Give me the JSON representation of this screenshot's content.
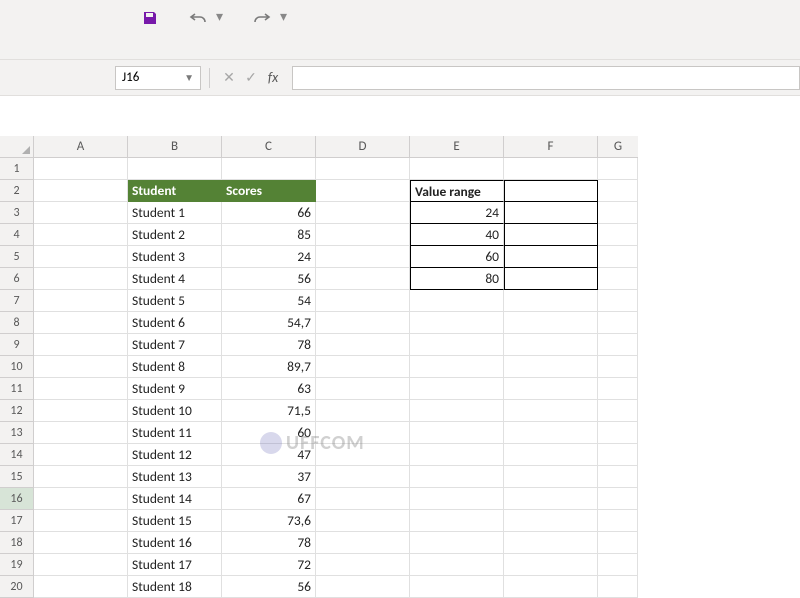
{
  "titlebar": {
    "save": "Save",
    "undo": "Undo",
    "redo": "Redo"
  },
  "formulabar": {
    "namebox": "J16",
    "cancel": "✕",
    "enter": "✓",
    "fx": "fx",
    "value": ""
  },
  "columns": [
    "A",
    "B",
    "C",
    "D",
    "E",
    "F",
    "G"
  ],
  "rows_visible": 20,
  "table_header": {
    "b": "Student",
    "c": "Scores"
  },
  "students": [
    {
      "name": "Student 1",
      "score": "66"
    },
    {
      "name": "Student 2",
      "score": "85"
    },
    {
      "name": "Student 3",
      "score": "24"
    },
    {
      "name": "Student 4",
      "score": "56"
    },
    {
      "name": "Student 5",
      "score": "54"
    },
    {
      "name": "Student 6",
      "score": "54,7"
    },
    {
      "name": "Student 7",
      "score": "78"
    },
    {
      "name": "Student 8",
      "score": "89,7"
    },
    {
      "name": "Student 9",
      "score": "63"
    },
    {
      "name": "Student 10",
      "score": "71,5"
    },
    {
      "name": "Student 11",
      "score": "60"
    },
    {
      "name": "Student 12",
      "score": "47"
    },
    {
      "name": "Student 13",
      "score": "37"
    },
    {
      "name": "Student 14",
      "score": "67"
    },
    {
      "name": "Student 15",
      "score": "73,6"
    },
    {
      "name": "Student 16",
      "score": "78"
    },
    {
      "name": "Student 17",
      "score": "72"
    },
    {
      "name": "Student 18",
      "score": "56"
    }
  ],
  "value_range": {
    "header": "Value range",
    "values": [
      "24",
      "40",
      "60",
      "80"
    ]
  },
  "watermark": "UFFCOM",
  "chart_data": {
    "type": "table",
    "title": "",
    "tables": [
      {
        "columns": [
          "Student",
          "Scores"
        ],
        "rows": [
          [
            "Student 1",
            66
          ],
          [
            "Student 2",
            85
          ],
          [
            "Student 3",
            24
          ],
          [
            "Student 4",
            56
          ],
          [
            "Student 5",
            54
          ],
          [
            "Student 6",
            54.7
          ],
          [
            "Student 7",
            78
          ],
          [
            "Student 8",
            89.7
          ],
          [
            "Student 9",
            63
          ],
          [
            "Student 10",
            71.5
          ],
          [
            "Student 11",
            60
          ],
          [
            "Student 12",
            47
          ],
          [
            "Student 13",
            37
          ],
          [
            "Student 14",
            67
          ],
          [
            "Student 15",
            73.6
          ],
          [
            "Student 16",
            78
          ],
          [
            "Student 17",
            72
          ],
          [
            "Student 18",
            56
          ]
        ]
      },
      {
        "columns": [
          "Value range",
          ""
        ],
        "rows": [
          [
            24,
            null
          ],
          [
            40,
            null
          ],
          [
            60,
            null
          ],
          [
            80,
            null
          ]
        ]
      }
    ]
  }
}
